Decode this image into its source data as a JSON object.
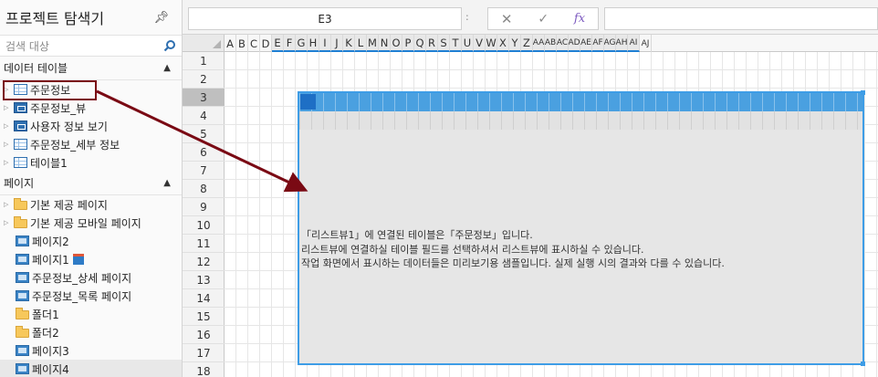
{
  "explorer": {
    "title": "프로젝트 탐색기",
    "search_placeholder": "검색 대상",
    "tables_section": {
      "label": "데이터 테이블",
      "items": [
        {
          "label": "주문정보",
          "icon": "table-icon"
        },
        {
          "label": "주문정보_뷰",
          "icon": "view-icon"
        },
        {
          "label": "사용자 정보 보기",
          "icon": "view-icon"
        },
        {
          "label": "주문정보_세부 정보",
          "icon": "table-icon"
        },
        {
          "label": "테이블1",
          "icon": "table-icon"
        }
      ]
    },
    "pages_section": {
      "label": "페이지",
      "items": [
        {
          "label": "기본 제공 페이지",
          "icon": "folder-icon"
        },
        {
          "label": "기본 제공 모바일 페이지",
          "icon": "folder-icon"
        },
        {
          "label": "페이지2",
          "icon": "page-icon"
        },
        {
          "label": "페이지1",
          "icon": "page-icon"
        },
        {
          "label": "주문정보_상세 페이지",
          "icon": "page-icon"
        },
        {
          "label": "주문정보_목록 페이지",
          "icon": "page-icon"
        },
        {
          "label": "폴더1",
          "icon": "folder-icon"
        },
        {
          "label": "폴더2",
          "icon": "folder-icon"
        },
        {
          "label": "페이지3",
          "icon": "page-icon"
        },
        {
          "label": "페이지4",
          "icon": "page-icon"
        }
      ]
    }
  },
  "formula_bar": {
    "name_box": "E3",
    "separator": ":",
    "cancel": "✕",
    "confirm": "✓",
    "fx": "fx",
    "formula": ""
  },
  "grid": {
    "columns": [
      "A",
      "B",
      "C",
      "D",
      "E",
      "F",
      "G",
      "H",
      "I",
      "J",
      "K",
      "L",
      "M",
      "N",
      "O",
      "P",
      "Q",
      "R",
      "S",
      "T",
      "U",
      "V",
      "W",
      "X",
      "Y",
      "Z",
      "AA",
      "AB",
      "AC",
      "AD",
      "AE",
      "AF",
      "AG",
      "AH",
      "AI",
      "AJ"
    ],
    "rows": [
      "1",
      "2",
      "3",
      "4",
      "5",
      "6",
      "7",
      "8",
      "9",
      "10",
      "11",
      "12",
      "13",
      "14",
      "15",
      "16",
      "17",
      "18"
    ],
    "selected_row": "3",
    "selection_start_column": "E"
  },
  "listview": {
    "message_lines": [
      "「리스트뷰1」에 연결된 테이블은「주문정보」입니다.",
      "리스트뷰에 연결하실 테이블 필드를 선택하셔서 리스트뷰에 표시하실 수 있습니다.",
      "작업 화면에서 표시하는 데이터들은 미리보기용 샘플입니다. 실제 실행 시의 결과와 다를 수 있습니다."
    ]
  },
  "colors": {
    "accent": "#3e9de6",
    "listview_header": "#4aa0e0",
    "callout": "#7a0a14"
  }
}
